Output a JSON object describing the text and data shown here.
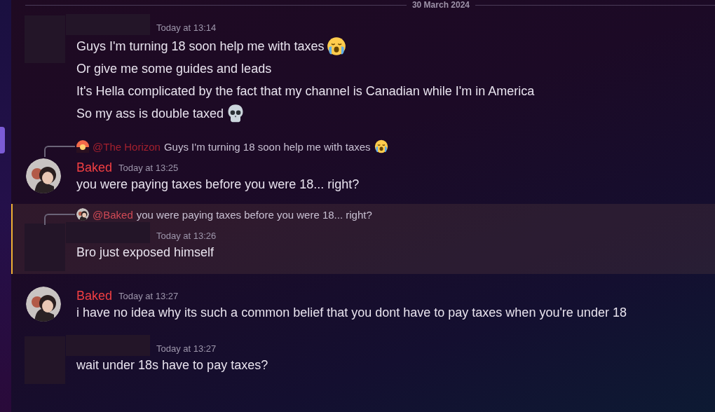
{
  "date_divider": "30 March 2024",
  "messages": [
    {
      "avatar": {
        "kind": "redacted"
      },
      "author_hidden": true,
      "time": "Today at 13:14",
      "highlighted": false,
      "lines": [
        {
          "text": "Guys I'm turning 18 soon help me with taxes",
          "emoji": {
            "kind": "crying"
          }
        },
        {
          "text": "Or give me some guides and leads"
        },
        {
          "text": "It's Hella complicated by the fact that my channel is Canadian while I'm in America"
        },
        {
          "text": "So my ass is double taxed",
          "emoji": {
            "kind": "skull"
          }
        }
      ]
    },
    {
      "avatar": {
        "kind": "photo"
      },
      "author_hidden": false,
      "author": "Baked",
      "time": "Today at 13:25",
      "highlighted": false,
      "reply": {
        "avatar": {
          "kind": "sunset"
        },
        "mention": "@The Horizon",
        "text": "Guys I'm turning 18 soon help me with taxes",
        "emoji": {
          "kind": "crying"
        }
      },
      "lines": [
        {
          "text": "you were paying taxes before you were 18... right?"
        }
      ]
    },
    {
      "avatar": {
        "kind": "redacted"
      },
      "author_hidden": true,
      "time": "Today at 13:26",
      "highlighted": true,
      "reply": {
        "avatar": {
          "kind": "photo"
        },
        "mention": "@Baked",
        "text": "you were paying taxes before you were 18... right?"
      },
      "lines": [
        {
          "text": "Bro just exposed himself"
        }
      ]
    },
    {
      "avatar": {
        "kind": "photo"
      },
      "author_hidden": false,
      "author": "Baked",
      "time": "Today at 13:27",
      "highlighted": false,
      "lines": [
        {
          "text": "i have no idea why its such a common belief that you dont have to pay taxes when you're under 18"
        }
      ]
    },
    {
      "avatar": {
        "kind": "redacted"
      },
      "author_hidden": true,
      "time": "Today at 13:27",
      "highlighted": false,
      "lines": [
        {
          "text": "wait under 18s have to pay taxes?"
        }
      ]
    }
  ]
}
